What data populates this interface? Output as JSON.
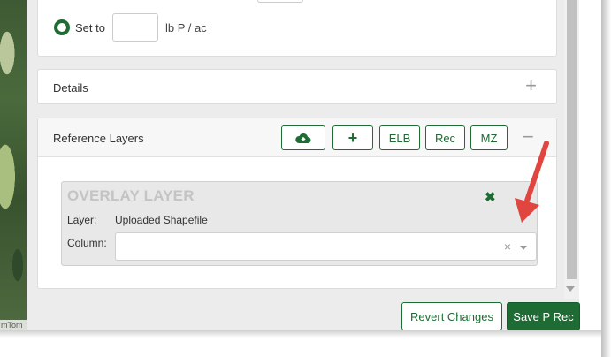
{
  "map": {
    "credit": "mTom"
  },
  "rate_card": {
    "set_to_label": "Set to",
    "set_to_value": "",
    "unit": "lb P / ac"
  },
  "details": {
    "title": "Details",
    "toggle": "+"
  },
  "reference_layers": {
    "title": "Reference Layers",
    "buttons": {
      "upload_icon": "cloud-upload-icon",
      "add": "+",
      "elb": "ELB",
      "rec": "Rec",
      "mz": "MZ"
    },
    "toggle": "−",
    "overlay": {
      "title": "OVERLAY LAYER",
      "close": "✖",
      "layer_label": "Layer:",
      "layer_value": "Uploaded Shapefile",
      "column_label": "Column:",
      "column_value": "",
      "clear": "×"
    }
  },
  "footer": {
    "revert_label": "Revert Changes",
    "save_label": "Save P Rec"
  },
  "colors": {
    "accent": "#1e6b34",
    "arrow": "#e0453f"
  }
}
